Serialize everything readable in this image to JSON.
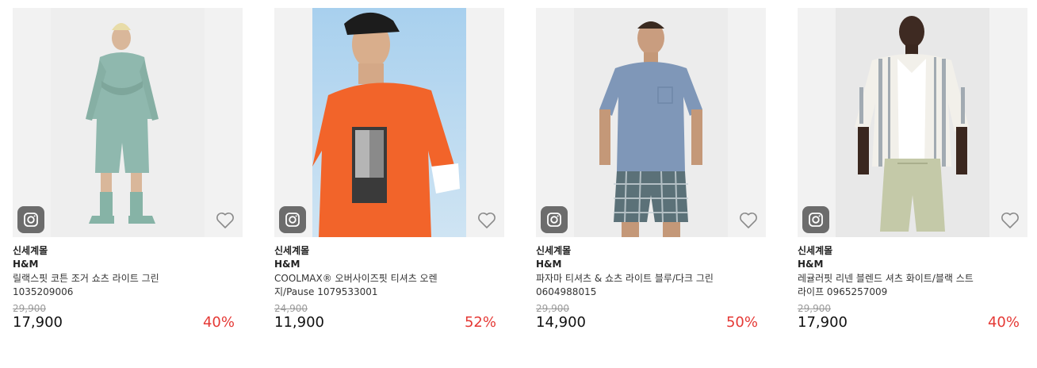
{
  "colors": {
    "discount": "#e53935",
    "thumb_bg": "#f2f2f2"
  },
  "products": [
    {
      "store": "신세계몰",
      "brand": "H&M",
      "name": "릴랙스핏 코튼 조거 쇼츠 라이트 그린 1035209006",
      "original_price": "29,900",
      "price": "17,900",
      "discount": "40%",
      "icons": [
        "instagram-icon",
        "heart-icon"
      ]
    },
    {
      "store": "신세계몰",
      "brand": "H&M",
      "name": "COOLMAX® 오버사이즈핏 티셔츠 오렌지/Pause 1079533001",
      "original_price": "24,900",
      "price": "11,900",
      "discount": "52%",
      "icons": [
        "instagram-icon",
        "heart-icon"
      ]
    },
    {
      "store": "신세계몰",
      "brand": "H&M",
      "name": "파자마 티셔츠 & 쇼츠 라이트 블루/다크 그린 0604988015",
      "original_price": "29,900",
      "price": "14,900",
      "discount": "50%",
      "icons": [
        "instagram-icon",
        "heart-icon"
      ]
    },
    {
      "store": "신세계몰",
      "brand": "H&M",
      "name": "레귤러핏 리넨 블렌드 셔츠 화이트/블랙 스트라이프 0965257009",
      "original_price": "29,900",
      "price": "17,900",
      "discount": "40%",
      "icons": [
        "instagram-icon",
        "heart-icon"
      ]
    }
  ]
}
